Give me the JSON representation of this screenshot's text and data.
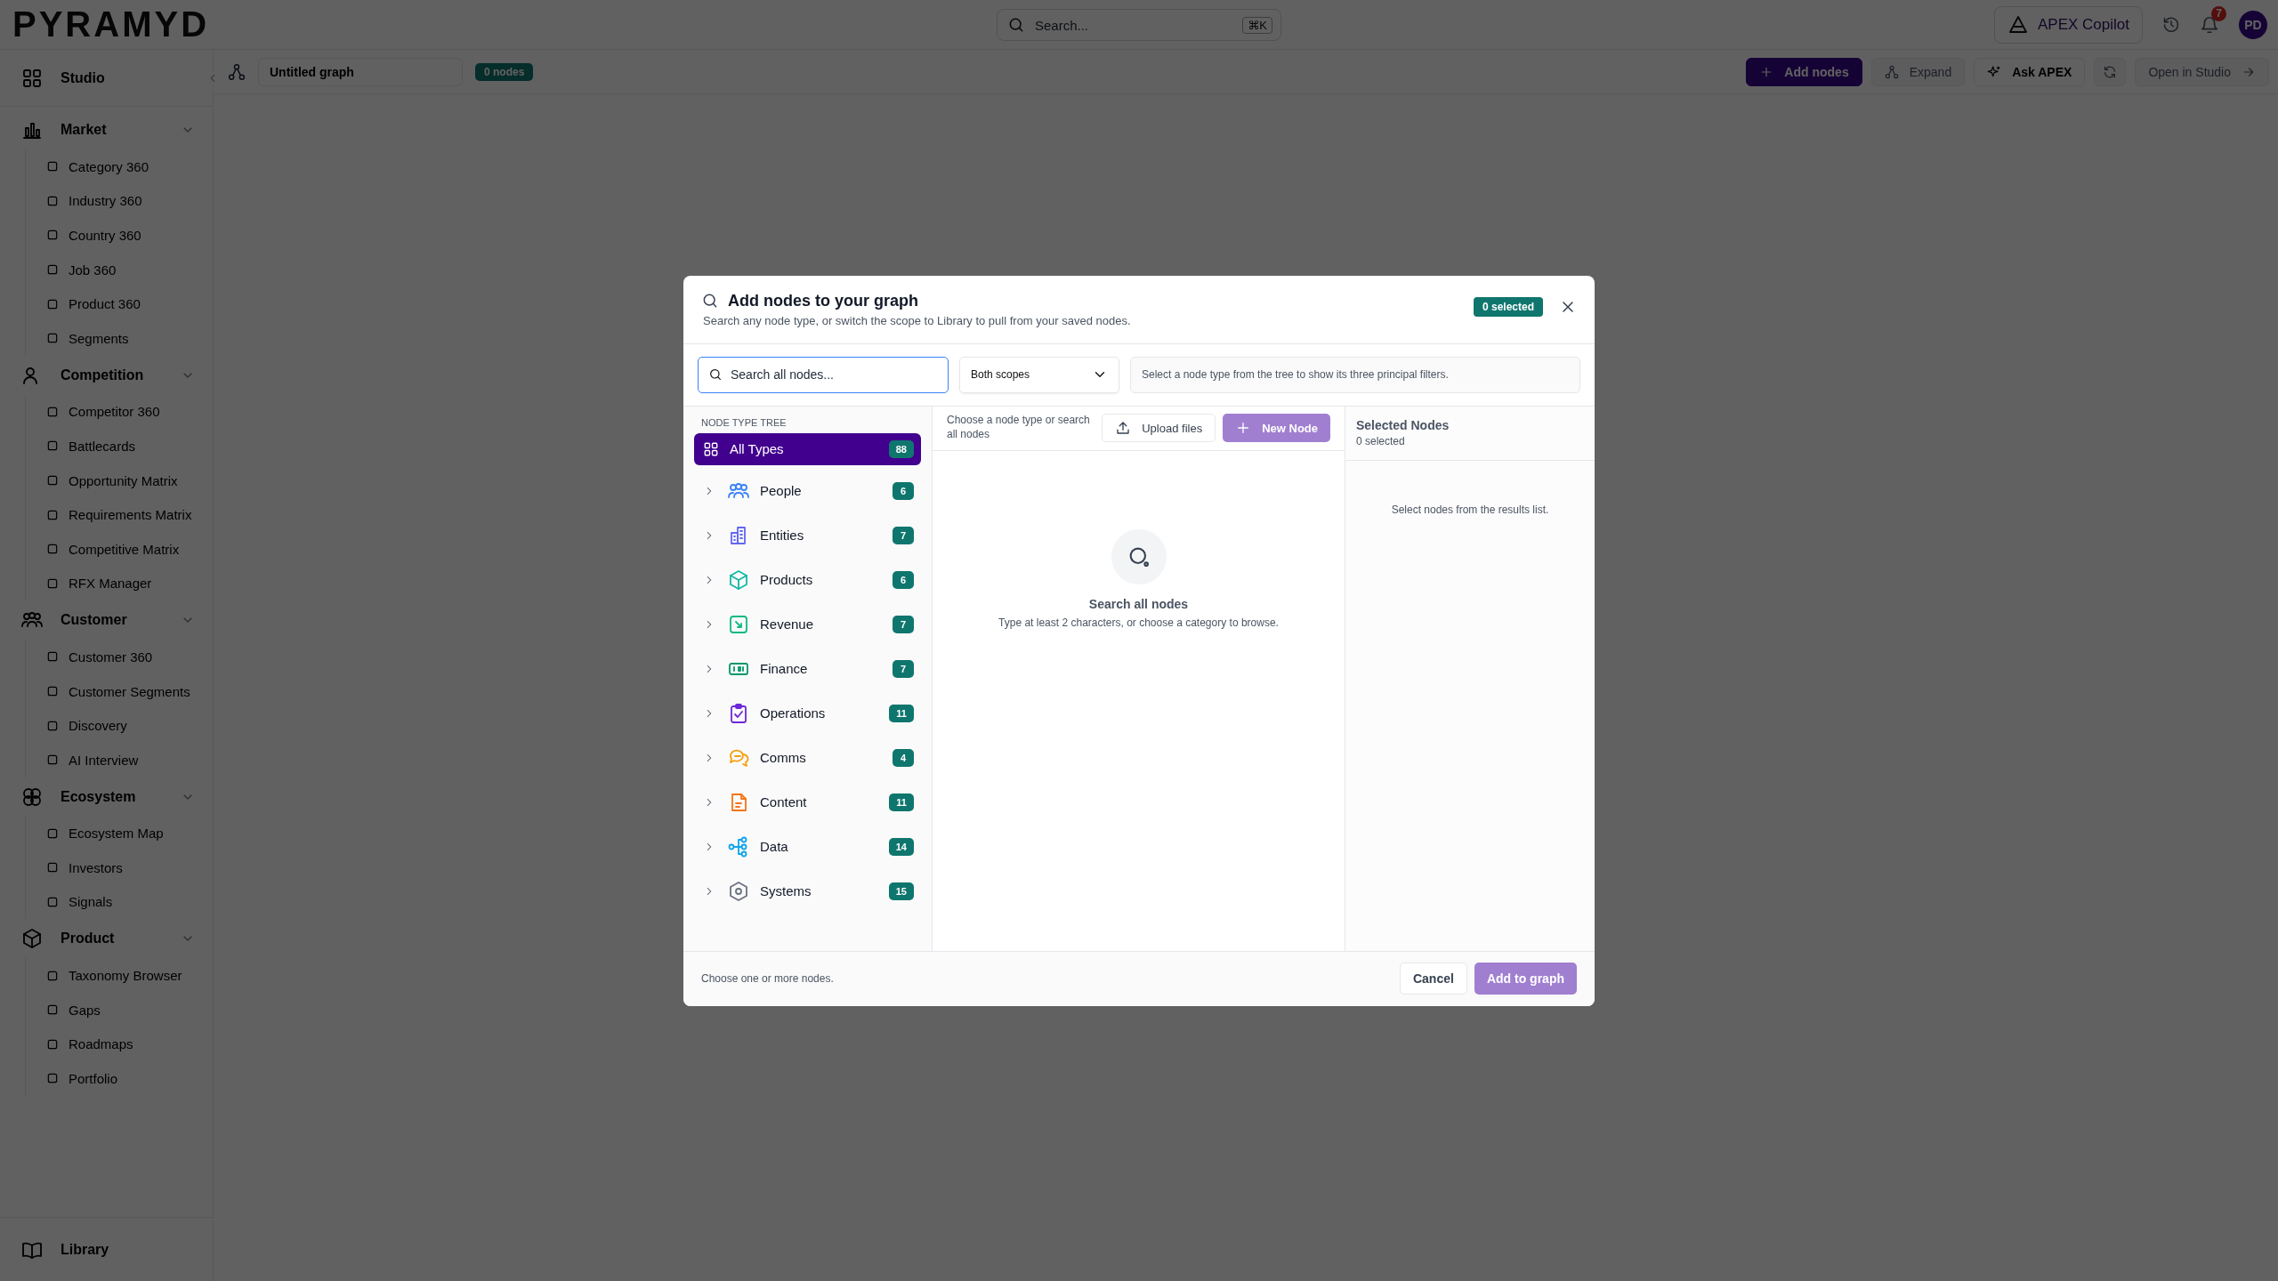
{
  "app": {
    "logo": "PYRAMYD"
  },
  "topbar": {
    "search": {
      "placeholder": "Search...",
      "shortcut": "⌘K"
    },
    "copilot": "APEX Copilot",
    "notifications": "7",
    "avatar": "PD"
  },
  "sidebar": {
    "top": {
      "label": "Studio"
    },
    "sections": [
      {
        "label": "Market",
        "expanded": true,
        "items": [
          "Category 360",
          "Industry 360",
          "Country 360",
          "Job 360",
          "Product 360",
          "Segments"
        ]
      },
      {
        "label": "Competition",
        "expanded": true,
        "items": [
          "Competitor 360",
          "Battlecards",
          "Opportunity Matrix",
          "Requirements Matrix",
          "Competitive Matrix",
          "RFX Manager"
        ]
      },
      {
        "label": "Customer",
        "expanded": true,
        "items": [
          "Customer 360",
          "Customer Segments",
          "Discovery",
          "AI Interview"
        ]
      },
      {
        "label": "Ecosystem",
        "expanded": true,
        "items": [
          "Ecosystem Map",
          "Investors",
          "Signals"
        ]
      },
      {
        "label": "Product",
        "expanded": true,
        "items": [
          "Taxonomy Browser",
          "Gaps",
          "Roadmaps",
          "Portfolio"
        ]
      }
    ],
    "bottom": {
      "label": "Library"
    }
  },
  "toolbar": {
    "graph_name": "Untitled graph",
    "node_count": "0 nodes",
    "buttons": [
      {
        "kind": "primary",
        "label": "Add nodes",
        "disabled": false
      },
      {
        "kind": "plain",
        "label": "Expand",
        "disabled": true
      },
      {
        "kind": "plain",
        "label": "Ask APEX",
        "disabled": false
      },
      {
        "kind": "icon",
        "disabled": true
      },
      {
        "kind": "plain",
        "label": "Open in Studio",
        "disabled": true
      }
    ]
  },
  "modal": {
    "title": "Add nodes to your graph",
    "subtitle": "Search any node type, or switch the scope to Library to pull from your saved nodes.",
    "selected_badge": "0 selected",
    "search": {
      "placeholder": "Search all nodes..."
    },
    "scope": {
      "value": "Both scopes"
    },
    "filter_hint": "Select a node type from the tree to show its three principal filters.",
    "tree": {
      "heading": "NODE TYPE TREE",
      "items": [
        {
          "label": "All Types",
          "count": "88",
          "selected": true
        },
        {
          "label": "People",
          "count": "6",
          "selected": false,
          "expanded": false,
          "color": "#3b82f6"
        },
        {
          "label": "Entities",
          "count": "7",
          "selected": false,
          "expanded": false,
          "color": "#6366f1"
        },
        {
          "label": "Products",
          "count": "6",
          "selected": false,
          "expanded": false,
          "color": "#14b8a6"
        },
        {
          "label": "Revenue",
          "count": "7",
          "selected": false,
          "expanded": false,
          "color": "#10b981"
        },
        {
          "label": "Finance",
          "count": "7",
          "selected": false,
          "expanded": false,
          "color": "#059669"
        },
        {
          "label": "Operations",
          "count": "11",
          "selected": false,
          "expanded": false,
          "color": "#6d28d9"
        },
        {
          "label": "Comms",
          "count": "4",
          "selected": false,
          "expanded": false,
          "color": "#f59e0b"
        },
        {
          "label": "Content",
          "count": "11",
          "selected": false,
          "expanded": false,
          "color": "#f97316"
        },
        {
          "label": "Data",
          "count": "14",
          "selected": false,
          "expanded": false,
          "color": "#0ea5e9"
        },
        {
          "label": "Systems",
          "count": "15",
          "selected": false,
          "expanded": false,
          "color": "#6b7280"
        }
      ]
    },
    "results": {
      "hint": "Choose a node type or search all nodes",
      "upload": {
        "label": "Upload files"
      },
      "new_node": {
        "label": "New Node",
        "disabled": true
      },
      "empty_title": "Search all nodes",
      "empty_text": "Type at least 2 characters, or choose a category to browse."
    },
    "selected_panel": {
      "title": "Selected Nodes",
      "count": "0 selected",
      "empty_text": "Select nodes from the results list."
    },
    "footer": {
      "hint": "Choose one or more nodes.",
      "cancel": "Cancel",
      "submit": {
        "label": "Add to graph",
        "disabled": true
      }
    }
  }
}
